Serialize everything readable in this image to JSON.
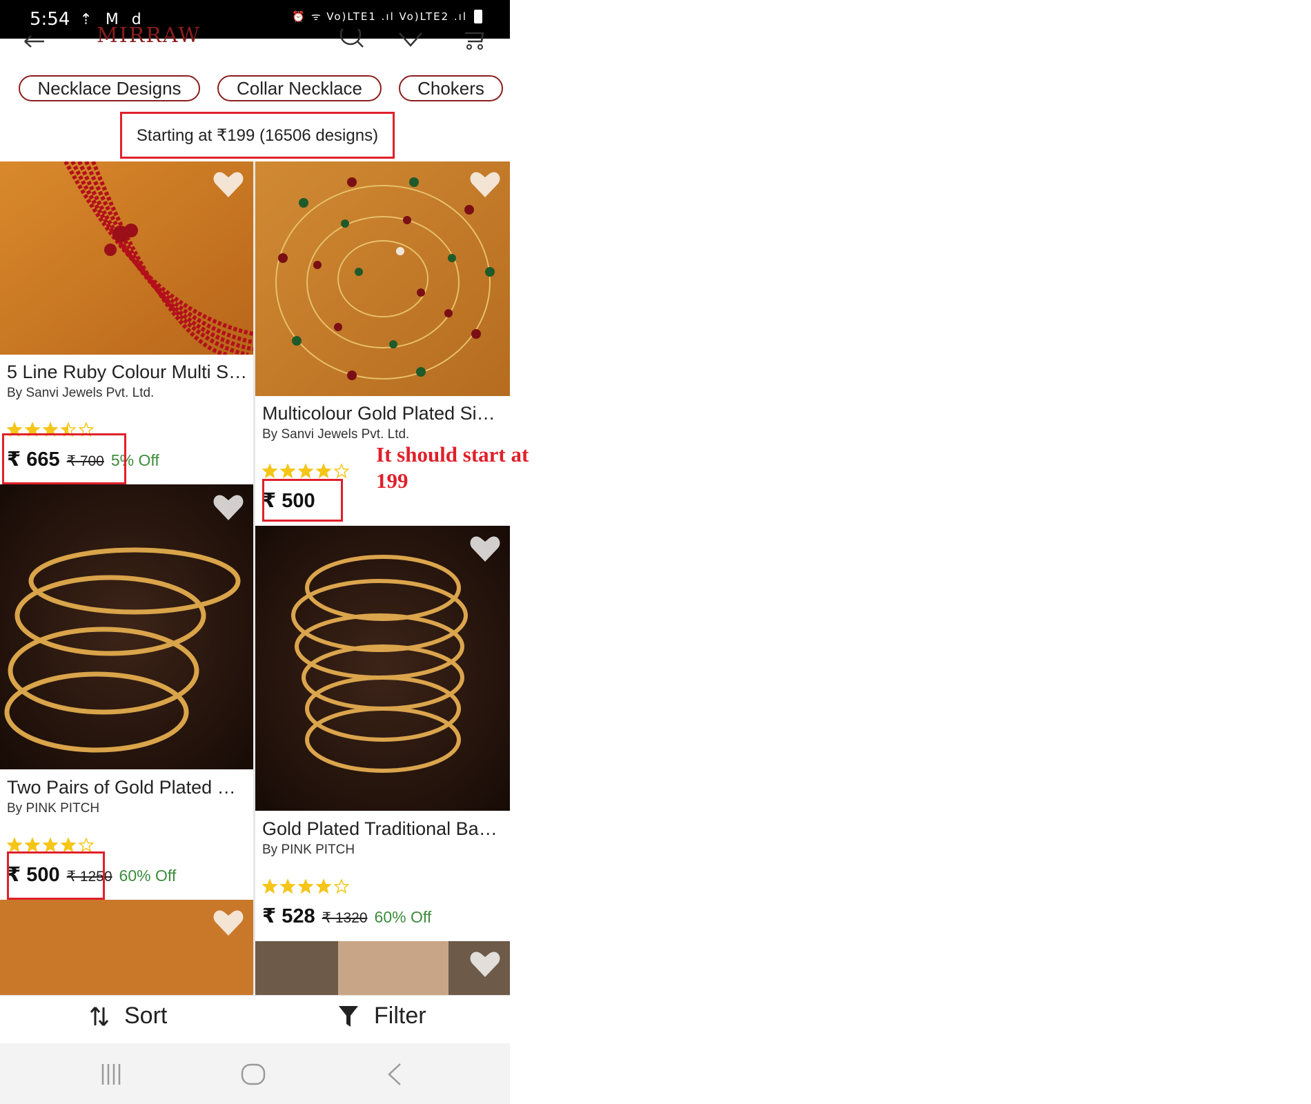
{
  "status_bar": {
    "time": "5:54",
    "left_icons": "⇡ M d",
    "right_icons": "⏰ ᯤ Vo)LTE1 .ıl Vo)LTE2 .ıl"
  },
  "header": {
    "logo": "MIRRAW"
  },
  "categories": [
    {
      "label": "Necklace Designs"
    },
    {
      "label": "Collar Necklace"
    },
    {
      "label": "Chokers"
    }
  ],
  "summary": "Starting at ₹199 (16506 designs)",
  "products": [
    {
      "name": "5 Line Ruby Colour Multi S…",
      "brand": "By Sanvi Jewels Pvt. Ltd.",
      "rating": 3.5,
      "price": "₹ 665",
      "mrp": "₹ 700",
      "discount": "5% Off"
    },
    {
      "name": "Multicolour Gold Plated Si…",
      "brand": "By Sanvi Jewels Pvt. Ltd.",
      "rating": 4,
      "price": "₹ 500",
      "mrp": "",
      "discount": ""
    },
    {
      "name": "Two Pairs of Gold Plated Gl…",
      "brand": "By PINK PITCH",
      "rating": 4,
      "price": "₹ 500",
      "mrp": "₹ 1250",
      "discount": "60% Off"
    },
    {
      "name": "Gold Plated Traditional Ba…",
      "brand": "By PINK PITCH",
      "rating": 4,
      "price": "₹ 528",
      "mrp": "₹ 1320",
      "discount": "60% Off"
    }
  ],
  "bottom_bar": {
    "sort_label": "Sort",
    "filter_label": "Filter"
  },
  "annotation": "It should start at 199",
  "colors": {
    "brand": "#8b1d1d",
    "highlight": "#e0202a",
    "discount": "#3c8c3c",
    "star": "#f5c518"
  }
}
